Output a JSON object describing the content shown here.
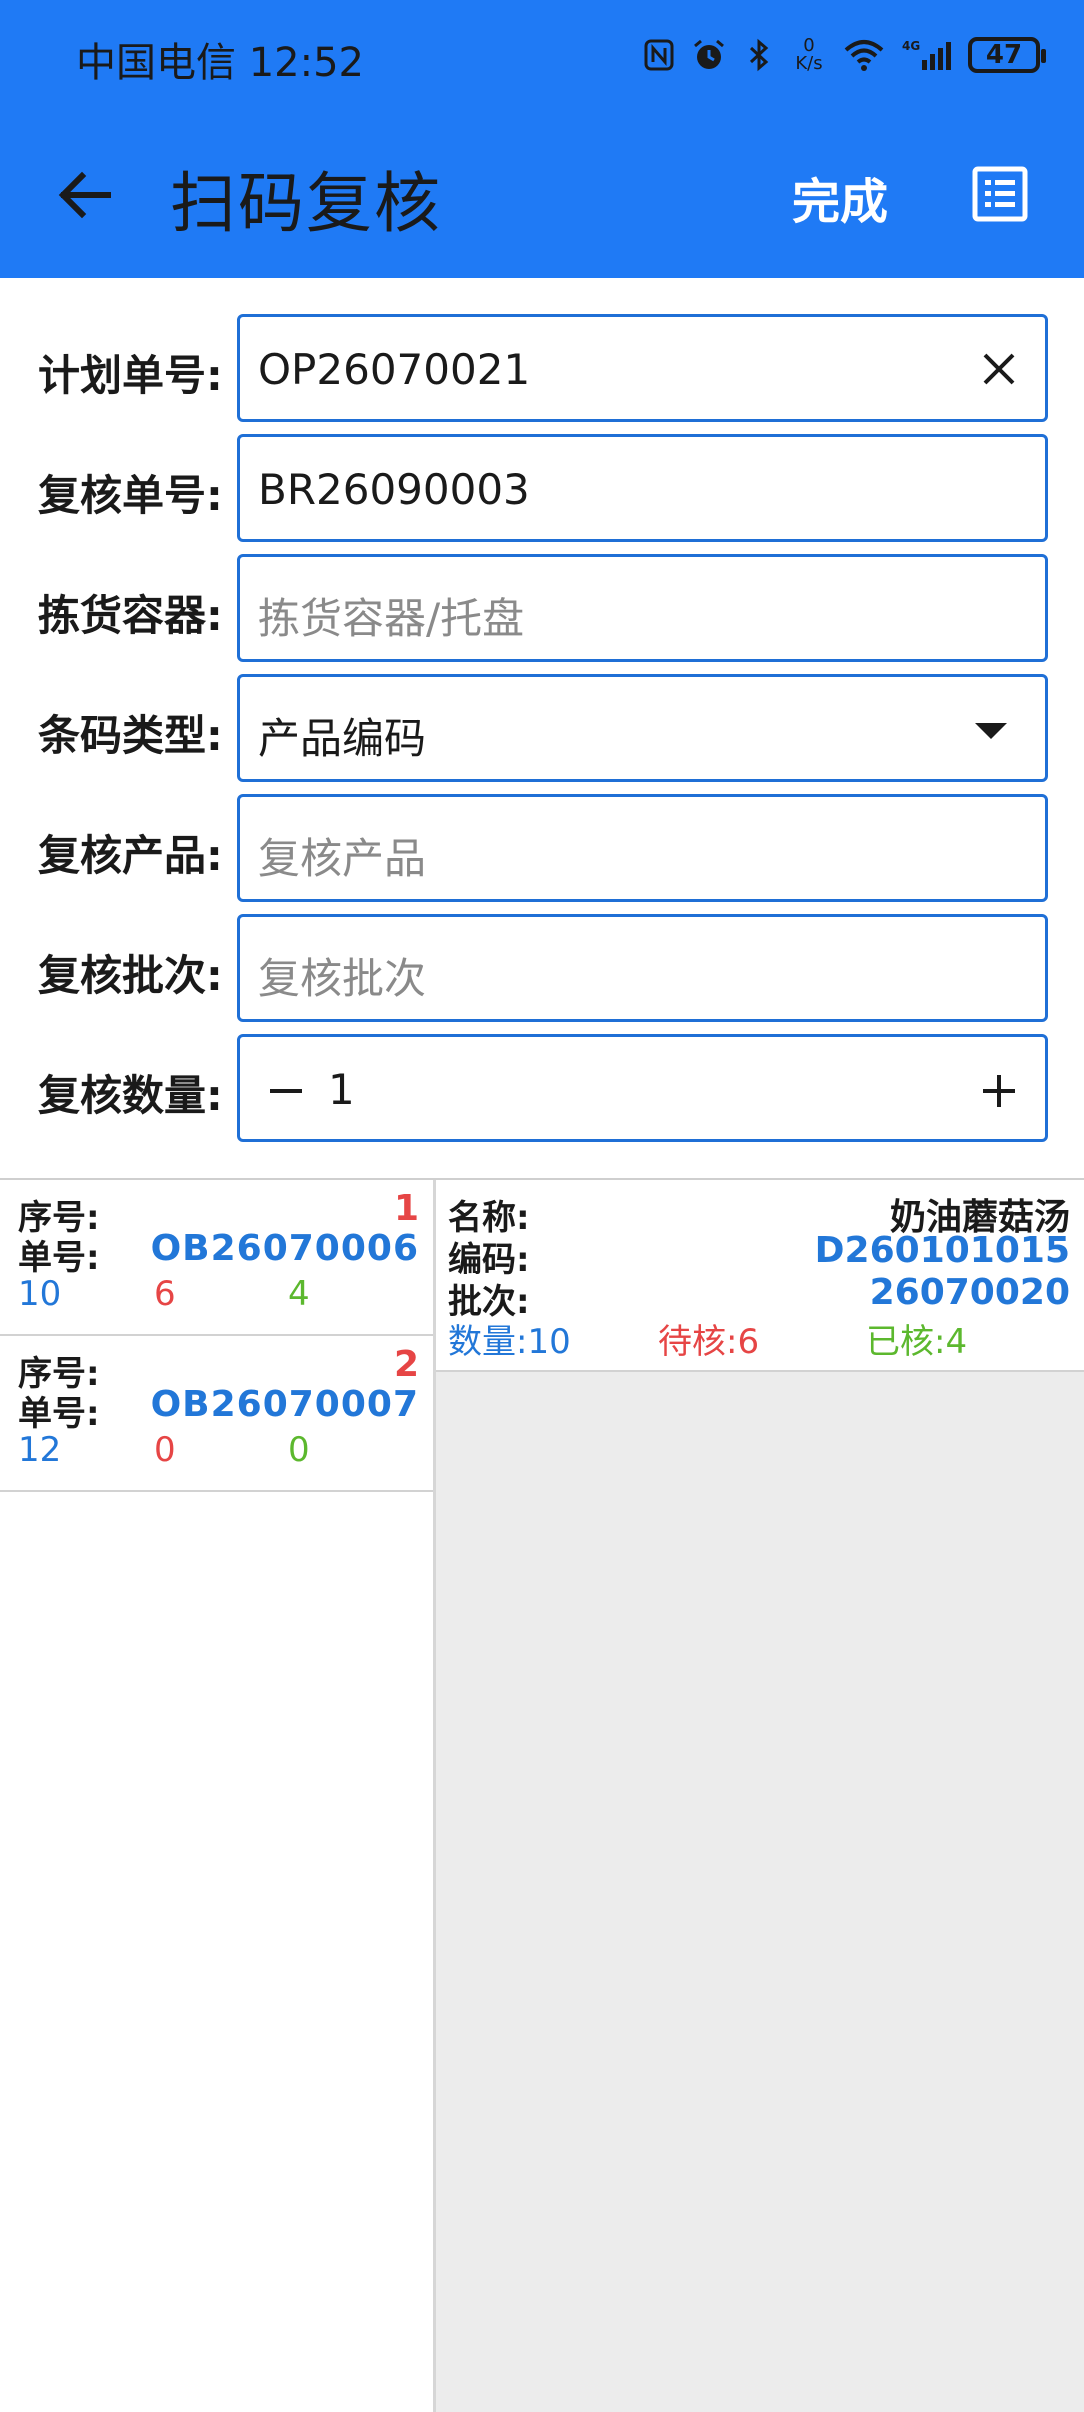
{
  "status_bar": {
    "carrier_time": "中国电信 12:52",
    "net_speed_value": "0",
    "net_speed_unit": "K/s",
    "battery": "47"
  },
  "app_bar": {
    "title": "扫码复核",
    "done_label": "完成"
  },
  "form": {
    "plan_no": {
      "label": "计划单号:",
      "value": "OP26070021"
    },
    "review_no": {
      "label": "复核单号:",
      "value": "BR26090003"
    },
    "container": {
      "label": "拣货容器:",
      "placeholder": "拣货容器/托盘"
    },
    "barcode_type": {
      "label": "条码类型:",
      "value": "产品编码"
    },
    "product": {
      "label": "复核产品:",
      "placeholder": "复核产品"
    },
    "batch": {
      "label": "复核批次:",
      "placeholder": "复核批次"
    },
    "quantity": {
      "label": "复核数量:",
      "value": "1"
    }
  },
  "orders": [
    {
      "seq_label": "序号:",
      "seq": "1",
      "no_label": "单号:",
      "no": "OB26070006",
      "total": "10",
      "pending": "6",
      "checked": "4"
    },
    {
      "seq_label": "序号:",
      "seq": "2",
      "no_label": "单号:",
      "no": "OB26070007",
      "total": "12",
      "pending": "0",
      "checked": "0"
    }
  ],
  "detail": {
    "name_label": "名称:",
    "name": "奶油蘑菇汤",
    "code_label": "编码:",
    "code": "D260101015",
    "batch_label": "批次:",
    "batch": "26070020",
    "qty": "数量:10",
    "pending": "待核:6",
    "checked": "已核:4"
  },
  "colors": {
    "primary": "#1f7af5",
    "field_border": "#1f6fd6",
    "total": "#2277d8",
    "pending": "#e64545",
    "checked": "#5cb82e"
  }
}
